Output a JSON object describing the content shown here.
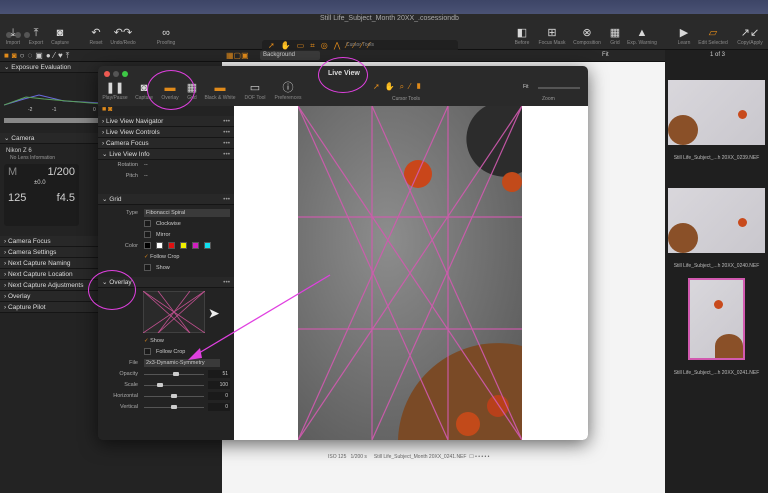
{
  "window_title": "Still Life_Subject_Month 20XX_.cosessiondb",
  "toolbar": {
    "left": [
      {
        "label": "Import",
        "icon": "import-icon"
      },
      {
        "label": "Export",
        "icon": "export-icon"
      },
      {
        "label": "Capture",
        "icon": "camera-icon"
      },
      {
        "label": "Reset",
        "icon": "reset-icon"
      },
      {
        "label": "Undo/Redo",
        "icon": "undo-icon"
      },
      {
        "label": "Proofing",
        "icon": "glasses-icon"
      }
    ],
    "cursor_tools_label": "Cursor Tools",
    "right": [
      {
        "label": "Before"
      },
      {
        "label": "Focus Mask"
      },
      {
        "label": "Composition"
      },
      {
        "label": "Grid"
      },
      {
        "label": "Exp. Warning"
      },
      {
        "label": "Learn"
      },
      {
        "label": "Edit Selected"
      },
      {
        "label": "Copy/Apply"
      }
    ]
  },
  "viewbar": {
    "background": "Background",
    "fit": "Fit",
    "counter": "1 of 3"
  },
  "left_panel": {
    "exposure": "Exposure Evaluation",
    "scale": [
      "-2",
      "-1",
      "0"
    ],
    "camera": "Camera",
    "camera_model": "Nikon Z 6",
    "lens": "No Lens Information",
    "mode": "M",
    "shutter": "1/200",
    "ev": "±0.0",
    "iso": "125",
    "aperture": "f4.5",
    "sections": [
      "Camera Focus",
      "Camera Settings",
      "Next Capture Naming",
      "Next Capture Location",
      "Next Capture Adjustments",
      "Overlay",
      "Capture Pilot"
    ]
  },
  "live_view": {
    "title": "Live View",
    "tools": [
      "Play/Pause",
      "Capture",
      "Overlay",
      "Grid",
      "Black & White",
      "DOF Tool",
      "Preferences"
    ],
    "cursor_tools": "Cursor Tools",
    "fit": "Fit",
    "zoom": "Zoom",
    "sections": [
      "Live View Navigator",
      "Live View Controls",
      "Camera Focus",
      "Live View Info"
    ],
    "info": {
      "rotation_label": "Rotation",
      "rotation": "--",
      "pitch_label": "Pitch",
      "pitch": "--"
    },
    "grid": {
      "title": "Grid",
      "type_label": "Type",
      "type": "Fibonacci Spiral",
      "clockwise": "Clockwise",
      "mirror": "Mirror",
      "color_label": "Color",
      "colors": [
        "#000000",
        "#ffffff",
        "#e01010",
        "#f0f000",
        "#d020c0",
        "#10e0f0"
      ],
      "follow_crop": "Follow Crop",
      "show": "Show"
    },
    "overlay": {
      "title": "Overlay",
      "show": "Show",
      "follow_crop": "Follow Crop",
      "file_label": "File",
      "file": "2x3-Dynamic-Symmetry",
      "opacity_label": "Opacity",
      "opacity": "51",
      "scale_label": "Scale",
      "scale": "100",
      "horizontal_label": "Horizontal",
      "horizontal": "0",
      "vertical_label": "Vertical",
      "vertical": "0"
    }
  },
  "status": {
    "iso": "ISO 125",
    "shutter": "1/200 s",
    "file": "Still Life_Subject_Month 20XX_0241.NEF"
  },
  "filmstrip": [
    {
      "name": "Still Life_Subject_...h 20XX_0239.NEF"
    },
    {
      "name": "Still Life_Subject_...h 20XX_0240.NEF"
    },
    {
      "name": "Still Life_Subject_...h 20XX_0241.NEF",
      "selected": true
    }
  ],
  "accent": "#e08a1a",
  "annotation_color": "#e040e0"
}
